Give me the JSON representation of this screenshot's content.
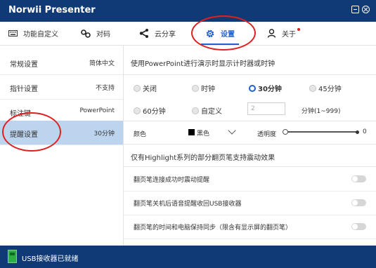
{
  "app": {
    "title": "Norwii Presenter"
  },
  "toolbar": {
    "tabs": [
      {
        "label": "功能自定义",
        "icon": "keyboard-icon"
      },
      {
        "label": "对码",
        "icon": "link-icon"
      },
      {
        "label": "云分享",
        "icon": "share-icon"
      },
      {
        "label": "设置",
        "icon": "gear-icon",
        "active": true
      },
      {
        "label": "关于",
        "icon": "user-icon",
        "badge": true
      }
    ]
  },
  "sidebar": {
    "items": [
      {
        "label": "常规设置",
        "value": "简体中文"
      },
      {
        "label": "指针设置",
        "value": "不支持"
      },
      {
        "label": "标注键",
        "value": "PowerPoint"
      },
      {
        "label": "提醒设置",
        "value": "30分钟",
        "active": true
      }
    ]
  },
  "timer": {
    "heading": "使用PowerPoint进行演示时显示计时器或时钟",
    "options": [
      "关闭",
      "时钟",
      "30分钟",
      "45分钟",
      "60分钟",
      "自定义"
    ],
    "selected": "30分钟",
    "custom_value": "2",
    "custom_range": "分钟(1~999)"
  },
  "appearance": {
    "color_label": "颜色",
    "color_value": "黑色",
    "color_swatch": "#000000",
    "opacity_label": "透明度",
    "opacity_value": "0"
  },
  "vibration": {
    "heading": "仅有Highlight系列的部分翻页笔支持震动效果",
    "rows": [
      {
        "label": "翻页笔连接成功时震动提醒",
        "enabled": false
      },
      {
        "label": "翻页笔关机后语音提醒收回USB接收器",
        "enabled": false
      },
      {
        "label": "翻页笔的时间和电脑保持同步（限含有显示屏的翻页笔）",
        "enabled": false
      }
    ]
  },
  "status": {
    "text": "USB接收器已就绪"
  },
  "colors": {
    "titlebar": "#103a75",
    "accent": "#1f5fd1",
    "sidebar_active": "#bcd4ee",
    "annotation": "#e02020"
  }
}
